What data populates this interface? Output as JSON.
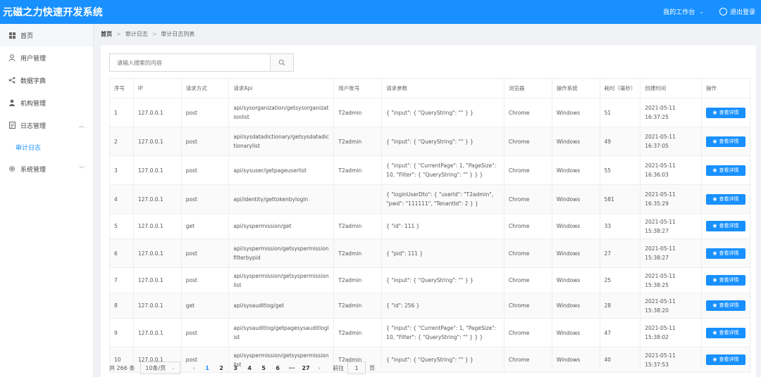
{
  "app": {
    "title": "元磁之力快速开发系统"
  },
  "header": {
    "workbench": "我的工作台",
    "logout": "退出登录"
  },
  "sidebar": {
    "items": [
      {
        "label": "首页",
        "icon": "grid-icon"
      },
      {
        "label": "用户管理",
        "icon": "user-icon"
      },
      {
        "label": "数据字典",
        "icon": "share-icon"
      },
      {
        "label": "机构管理",
        "icon": "person-icon"
      },
      {
        "label": "日志管理",
        "icon": "document-icon",
        "expanded": true
      },
      {
        "label": "系统管理",
        "icon": "gear-icon"
      }
    ],
    "sub_items": [
      {
        "label": "审计日志"
      }
    ]
  },
  "breadcrumb": [
    "首页",
    "审计日志",
    "审计日志列表"
  ],
  "search": {
    "placeholder": "请输入搜索的内容"
  },
  "table": {
    "columns": [
      "序号",
      "IP",
      "请求方式",
      "请求Api",
      "用户账号",
      "请求参数",
      "浏览器",
      "操作系统",
      "耗时（毫秒）",
      "创建时间",
      "操作"
    ],
    "action_label": "查看详情",
    "rows": [
      {
        "no": "1",
        "ip": "127.0.0.1",
        "method": "post",
        "api": "api/sysorganization/getsysorganizationlist",
        "user": "T2admin",
        "params": "{ \"input\": { \"QueryString\": \"\" } }",
        "browser": "Chrome",
        "os": "Windows",
        "ms": "51",
        "time": "2021-05-11 16:37:25"
      },
      {
        "no": "2",
        "ip": "127.0.0.1",
        "method": "post",
        "api": "api/sysdatadictionary/getsysdatadictionarylist",
        "user": "T2admin",
        "params": "{ \"input\": { \"QueryString\": \"\" } }",
        "browser": "Chrome",
        "os": "Windows",
        "ms": "49",
        "time": "2021-05-11 16:37:05"
      },
      {
        "no": "3",
        "ip": "127.0.0.1",
        "method": "post",
        "api": "api/sysuser/getpageuserlist",
        "user": "T2admin",
        "params": "{ \"input\": { \"CurrentPage\": 1, \"PageSize\": 10, \"Filter\": { \"QueryString\": \"\" } } }",
        "browser": "Chrome",
        "os": "Windows",
        "ms": "55",
        "time": "2021-05-11 16:36:03"
      },
      {
        "no": "4",
        "ip": "127.0.0.1",
        "method": "post",
        "api": "api/identity/gettokenbylogin",
        "user": "",
        "params": "{ \"loginUserDto\": { \"userId\": \"T2admin\", \"pwd\": \"111111\", \"TenantId\": 2 } }",
        "browser": "Chrome",
        "os": "Windows",
        "ms": "581",
        "time": "2021-05-11 16:35:29"
      },
      {
        "no": "5",
        "ip": "127.0.0.1",
        "method": "get",
        "api": "api/syspermission/get",
        "user": "T2admin",
        "params": "{ \"id\": 111 }",
        "browser": "Chrome",
        "os": "Windows",
        "ms": "33",
        "time": "2021-05-11 15:38:27"
      },
      {
        "no": "6",
        "ip": "127.0.0.1",
        "method": "post",
        "api": "api/syspermission/getsyspermissionfilterbypid",
        "user": "T2admin",
        "params": "{ \"pid\": 111 }",
        "browser": "Chrome",
        "os": "Windows",
        "ms": "27",
        "time": "2021-05-11 15:38:27"
      },
      {
        "no": "7",
        "ip": "127.0.0.1",
        "method": "post",
        "api": "api/syspermission/getsyspermissionlist",
        "user": "T2admin",
        "params": "{ \"input\": { \"QueryString\": \"\" } }",
        "browser": "Chrome",
        "os": "Windows",
        "ms": "25",
        "time": "2021-05-11 15:38:25"
      },
      {
        "no": "8",
        "ip": "127.0.0.1",
        "method": "get",
        "api": "api/sysauditlog/get",
        "user": "T2admin",
        "params": "{ \"id\": 256 }",
        "browser": "Chrome",
        "os": "Windows",
        "ms": "28",
        "time": "2021-05-11 15:38:20"
      },
      {
        "no": "9",
        "ip": "127.0.0.1",
        "method": "post",
        "api": "api/sysauditlog/getpagesysauditloglist",
        "user": "T2admin",
        "params": "{ \"input\": { \"CurrentPage\": 1, \"PageSize\": 10, \"Filter\": { \"QueryString\": \"\" } } }",
        "browser": "Chrome",
        "os": "Windows",
        "ms": "47",
        "time": "2021-05-11 15:38:02"
      },
      {
        "no": "10",
        "ip": "127.0.0.1",
        "method": "post",
        "api": "api/syspermission/getsyspermissionlist",
        "user": "T2admin",
        "params": "{ \"input\": { \"QueryString\": \"\" } }",
        "browser": "Chrome",
        "os": "Windows",
        "ms": "40",
        "time": "2021-05-11 15:37:53"
      }
    ]
  },
  "pagination": {
    "total": "共 266 条",
    "page_size": "10条/页",
    "pages": [
      "1",
      "2",
      "3",
      "4",
      "5",
      "6",
      "···",
      "27"
    ],
    "current": "1",
    "goto_prefix": "前往",
    "goto_value": "1",
    "goto_suffix": "页"
  }
}
